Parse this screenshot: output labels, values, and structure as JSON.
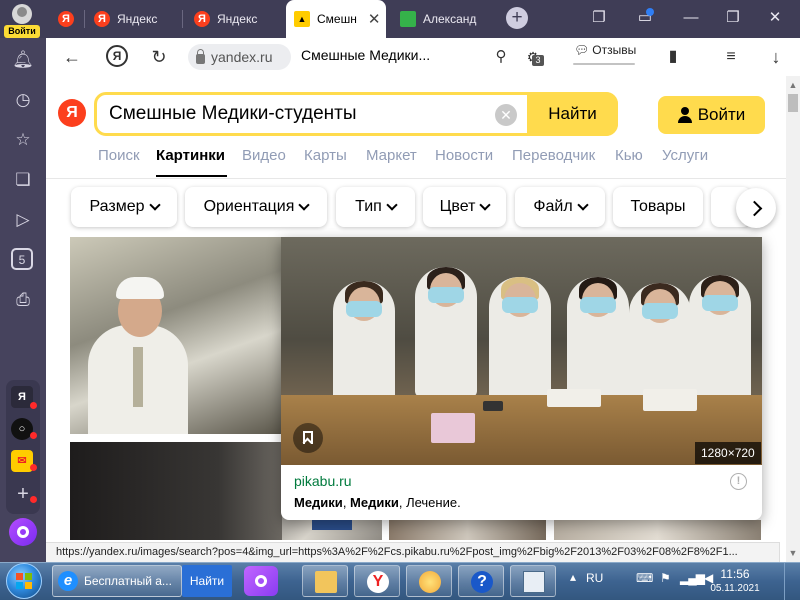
{
  "browser": {
    "profile": {
      "login_label": "Войти"
    },
    "tabs": [
      {
        "label": "Яндекс",
        "favicon": "Я"
      },
      {
        "label": "Яндекс",
        "favicon": "Я"
      },
      {
        "label": "Смешн",
        "favicon": "images"
      },
      {
        "label": "Александ",
        "favicon": "green"
      }
    ],
    "address": {
      "domain": "yandex.ru",
      "page_title": "Смешные Медики...",
      "reviews_label": "Отзывы",
      "tab_count_badge": "3"
    },
    "ya_button_glyph": "Я"
  },
  "search": {
    "logo": "Я",
    "query": "Смешные Медики-студенты",
    "find_label": "Найти",
    "signin_label": "Войти"
  },
  "services": [
    {
      "label": "Поиск"
    },
    {
      "label": "Картинки"
    },
    {
      "label": "Видео"
    },
    {
      "label": "Карты"
    },
    {
      "label": "Маркет"
    },
    {
      "label": "Новости"
    },
    {
      "label": "Переводчик"
    },
    {
      "label": "Кью"
    },
    {
      "label": "Услуги"
    }
  ],
  "filters": [
    {
      "label": "Размер"
    },
    {
      "label": "Ориентация"
    },
    {
      "label": "Тип"
    },
    {
      "label": "Цвет"
    },
    {
      "label": "Файл"
    },
    {
      "label": "Товары"
    }
  ],
  "preview": {
    "dimensions": "1280×720",
    "domain": "pikabu.ru",
    "desc_bold_1": "Медики",
    "desc_sep": ", ",
    "desc_bold_2": "Медики",
    "desc_rest": ", Лечение.",
    "info_glyph": "!"
  },
  "status_url": "https://yandex.ru/images/search?pos=4&img_url=https%3A%2F%2Fcs.pikabu.ru%2Fpost_img%2Fbig%2F2013%2F03%2F08%2F8%2F1...",
  "sidebar": {
    "apps": [
      {
        "label": "Я"
      },
      {
        "label": "○"
      }
    ],
    "calendar_day": "5"
  },
  "taskbar": {
    "ie_task_label": "Бесплатный а...",
    "find_label": "Найти",
    "language": "RU",
    "time": "11:56",
    "date": "05.11.2021"
  },
  "colors": {
    "accent_yellow": "#ffdb4d",
    "yandex_red": "#fc3f1d",
    "tabbar_bg": "#3f3d56",
    "link_green": "#007a3d"
  }
}
